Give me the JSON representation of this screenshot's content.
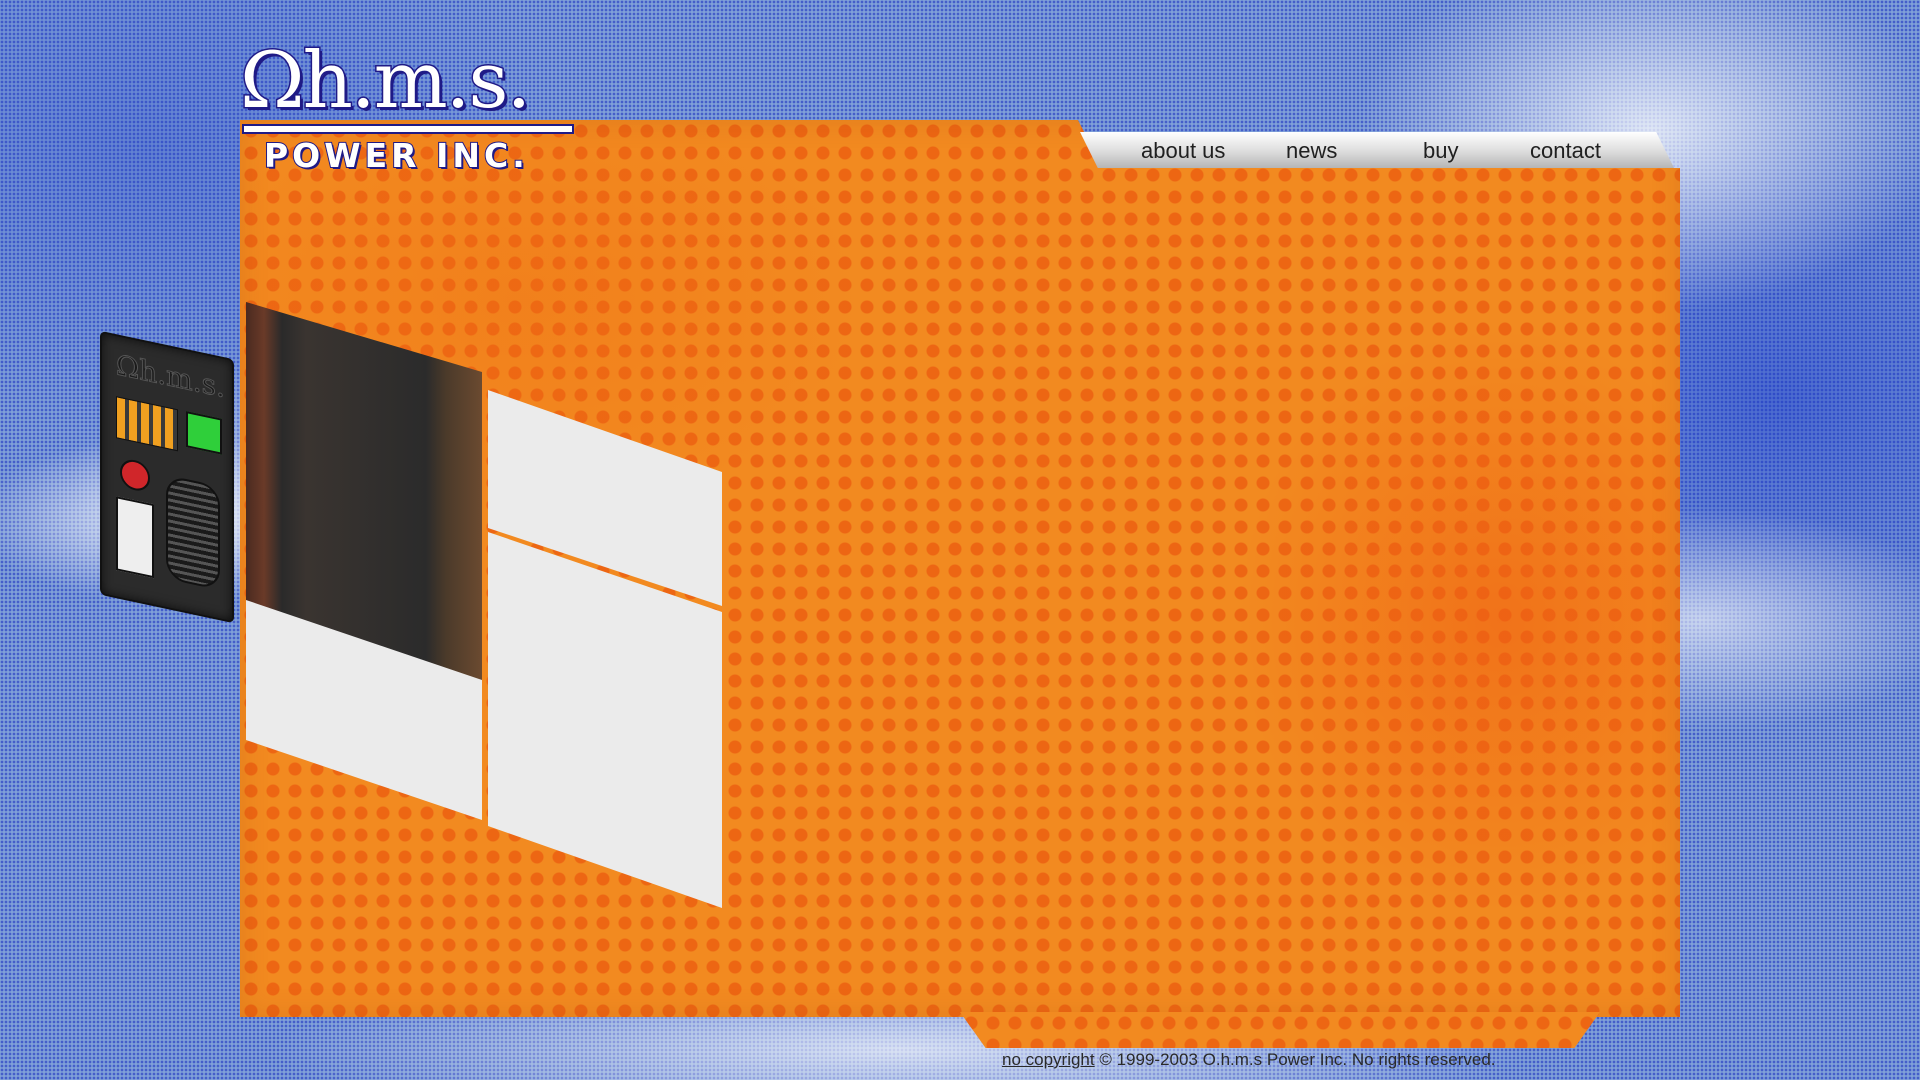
{
  "logo": {
    "top": "Ωh.m.s.",
    "bottom": "POWER INC."
  },
  "nav": {
    "items": [
      {
        "label": "about us"
      },
      {
        "label": "news"
      },
      {
        "label": "buy"
      },
      {
        "label": "contact"
      }
    ]
  },
  "photo": {
    "device_logo": "Ωh.m.s."
  },
  "footer": {
    "link_text": "no copyright",
    "rest_text": " © 1999-2003 O.h.m.s Power Inc. No rights reserved."
  },
  "colors": {
    "panel_orange": "#f28a20",
    "dot_orange": "#ec6212",
    "logo_navy": "#1f1a86",
    "box_grey": "#ebebeb"
  }
}
